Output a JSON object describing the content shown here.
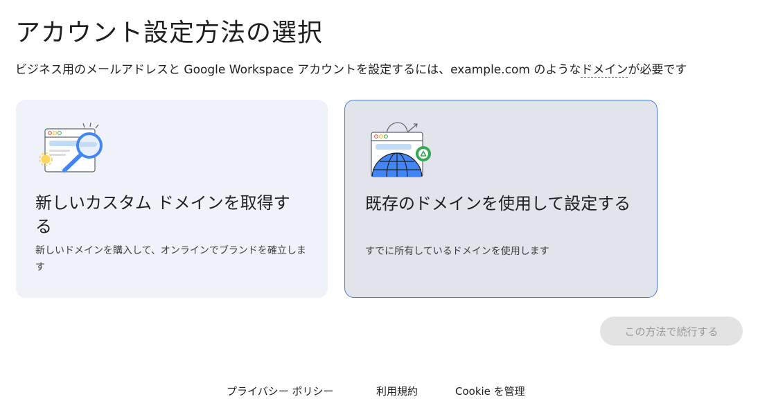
{
  "header": {
    "title": "アカウント設定方法の選択",
    "subtitle_before": "ビジネス用のメールアドレスと Google Workspace アカウントを設定するには、example.com のような",
    "subtitle_term": "ドメイン",
    "subtitle_after": "が必要です"
  },
  "options": [
    {
      "icon": "browser-magnifier-icon",
      "title": "新しいカスタム ドメインを取得する",
      "description": "新しいドメインを購入して、オンラインでブランドを確立します"
    },
    {
      "icon": "browser-globe-icon",
      "title": "既存のドメインを使用して設定する",
      "description": "すでに所有しているドメインを使用します",
      "selected": true
    }
  ],
  "actions": {
    "continue_label": "この方法で続行する",
    "continue_enabled": false
  },
  "footer": {
    "privacy": "プライバシー ポリシー",
    "terms": "利用規約",
    "cookie": "Cookie を管理"
  },
  "colors": {
    "selected_border": "#4a7ddc",
    "card_bg": "#eff2f8",
    "selected_card_bg": "#e1e4ea",
    "disabled_button_bg": "#e3e3e3"
  }
}
